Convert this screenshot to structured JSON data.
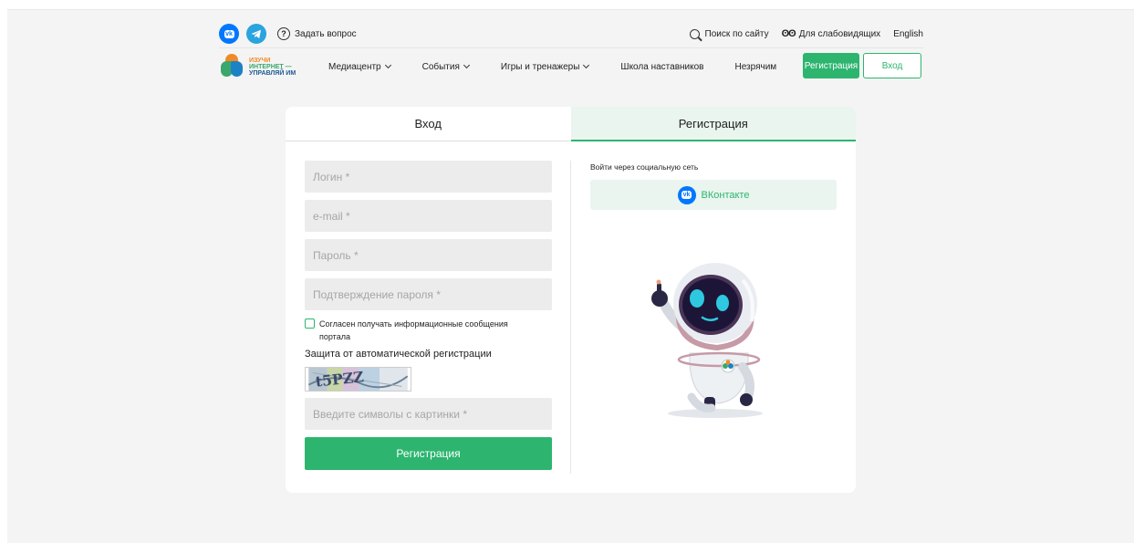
{
  "header": {
    "ask_label": "Задать вопрос",
    "search_label": "Поиск по сайту",
    "accessibility_label": "Для слабовидящих",
    "language_label": "English"
  },
  "logo": {
    "line1": "ИЗУЧИ",
    "line2": "ИНТЕРНЕТ —",
    "line3": "УПРАВЛЯЙ ИМ"
  },
  "nav": {
    "items": [
      {
        "label": "Медиацентр",
        "dropdown": true
      },
      {
        "label": "События",
        "dropdown": true
      },
      {
        "label": "Игры и тренажеры",
        "dropdown": true
      },
      {
        "label": "Школа наставников",
        "dropdown": false
      },
      {
        "label": "Незрячим",
        "dropdown": false
      }
    ],
    "register_label": "Регистрация",
    "login_label": "Вход"
  },
  "tabs": {
    "login": "Вход",
    "register": "Регистрация",
    "active": "register"
  },
  "form": {
    "login_placeholder": "Логин *",
    "email_placeholder": "e-mail *",
    "password_placeholder": "Пароль *",
    "confirm_placeholder": "Подтверждение пароля *",
    "consent_label": "Согласен получать информационные сообщения портала",
    "consent_checked": false,
    "captcha_title": "Защита от автоматической регистрации",
    "captcha_placeholder": "Введите символы с картинки *",
    "submit_label": "Регистрация"
  },
  "social": {
    "title": "Войти через социальную сеть",
    "vk_label": "ВКонтакте"
  },
  "colors": {
    "accent": "#2db56f",
    "vk": "#0077ff",
    "telegram": "#2aa3df",
    "tab_active_bg": "#e9f5ee"
  }
}
